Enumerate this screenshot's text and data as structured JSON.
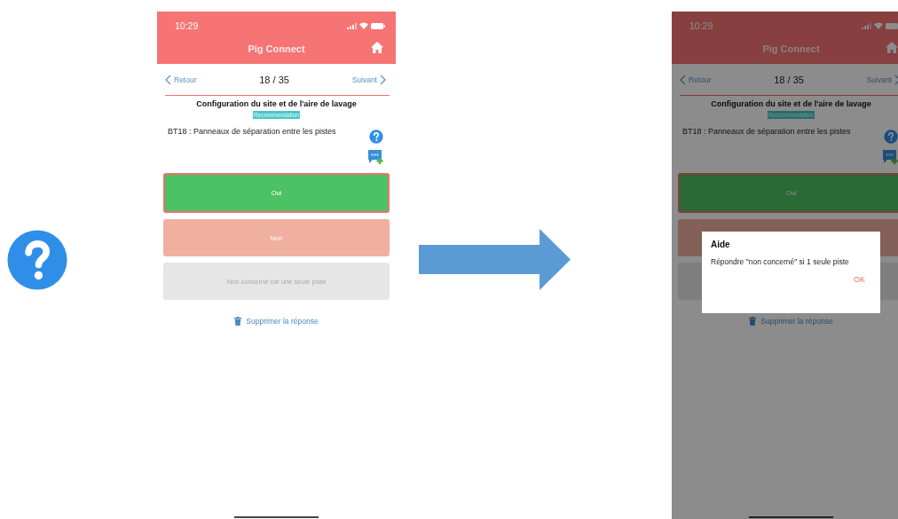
{
  "screens": [
    {
      "status_time": "10:29",
      "app_title": "Pig Connect",
      "back": "Retour",
      "progress": "18 / 35",
      "next": "Suivant",
      "section_title": "Configuration du site et de l'aire de lavage",
      "tag": "Recommandation",
      "question": "BT18 : Panneaux de séparation entre les pistes",
      "answers": [
        {
          "label": "Oui",
          "kind": "yes",
          "selected": true
        },
        {
          "label": "Non",
          "kind": "no",
          "selected": false
        },
        {
          "label": "Non concerné car une seule piste",
          "kind": "na",
          "selected": false
        }
      ],
      "delete": "Supprimer la réponse"
    },
    {
      "status_time": "10:29",
      "app_title": "Pig Connect",
      "back": "Retour",
      "progress": "18 / 35",
      "next": "Suivant",
      "section_title": "Configuration du site et de l'aire de lavage",
      "tag": "Recommandation",
      "question": "BT18 : Panneaux de séparation entre les pistes",
      "answers": [
        {
          "label": "Oui",
          "kind": "yes",
          "selected": true
        },
        {
          "kind": "no",
          "selected": false
        },
        {
          "kind": "na",
          "selected": false
        }
      ],
      "delete": "Supprimer la réponse",
      "dialog": {
        "title": "Aide",
        "message": "Répondre \"non concerné\" si 1 seule piste",
        "button": "OK"
      }
    }
  ]
}
